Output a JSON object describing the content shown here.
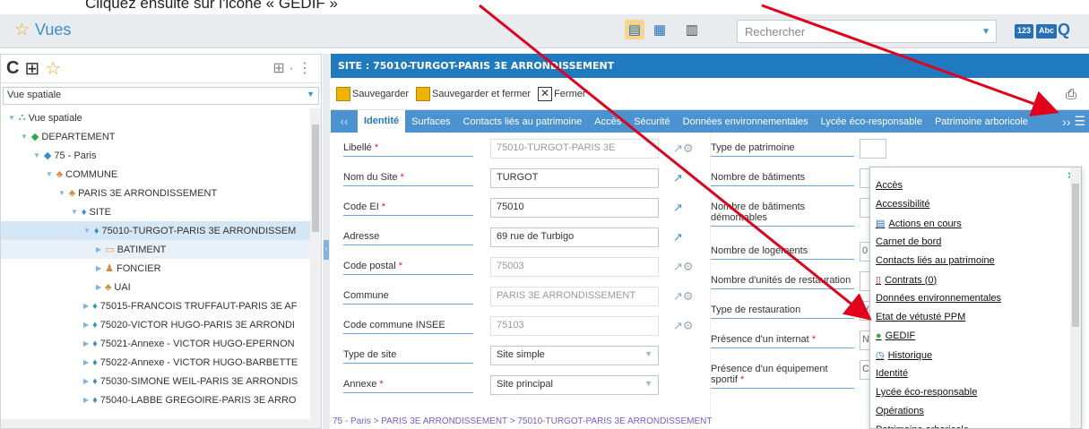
{
  "doc_text": "Cliquez ensuite sur l'icône « GEDIF »",
  "app": {
    "title": "Vues"
  },
  "search": {
    "placeholder": "Rechercher"
  },
  "toolbar_badges": {
    "num": "123",
    "abc": "Abc"
  },
  "left": {
    "view_select": "Vue spatiale",
    "tree": [
      {
        "label": "Vue spatiale",
        "indent": 8,
        "icon": "tree-icon",
        "state": "open"
      },
      {
        "label": "DEPARTEMENT",
        "indent": 22,
        "icon": "folder-green-icon",
        "state": "open"
      },
      {
        "label": "75 - Paris",
        "indent": 36,
        "icon": "globe-icon",
        "state": "open"
      },
      {
        "label": "COMMUNE",
        "indent": 50,
        "icon": "commune-icon",
        "state": "open"
      },
      {
        "label": "PARIS 3E ARRONDISSEMENT",
        "indent": 64,
        "icon": "commune-icon",
        "state": "open"
      },
      {
        "label": "SITE",
        "indent": 78,
        "icon": "site-icon",
        "state": "open"
      },
      {
        "label": "75010-TURGOT-PARIS 3E ARRONDISSEM",
        "indent": 92,
        "icon": "site-icon",
        "state": "open",
        "selected": true
      },
      {
        "label": "BATIMENT",
        "indent": 106,
        "icon": "building-icon",
        "state": "closed",
        "highlight": true
      },
      {
        "label": "FONCIER",
        "indent": 106,
        "icon": "foncier-icon",
        "state": "closed"
      },
      {
        "label": "UAI",
        "indent": 106,
        "icon": "commune-icon",
        "state": "closed"
      },
      {
        "label": "75015-FRANCOIS TRUFFAUT-PARIS 3E AF",
        "indent": 92,
        "icon": "site-icon",
        "state": "closed"
      },
      {
        "label": "75020-VICTOR HUGO-PARIS 3E ARRONDI",
        "indent": 92,
        "icon": "site-icon",
        "state": "closed"
      },
      {
        "label": "75021-Annexe - VICTOR HUGO-EPERNON",
        "indent": 92,
        "icon": "site-icon",
        "state": "closed"
      },
      {
        "label": "75022-Annexe - VICTOR HUGO-BARBETTE",
        "indent": 92,
        "icon": "site-icon",
        "state": "closed"
      },
      {
        "label": "75030-SIMONE WEIL-PARIS 3E ARRONDIS",
        "indent": 92,
        "icon": "site-icon",
        "state": "closed"
      },
      {
        "label": "75040-LABBE GREGOIRE-PARIS 3E ARRO",
        "indent": 92,
        "icon": "site-icon",
        "state": "closed"
      }
    ]
  },
  "main": {
    "header": "SITE : 75010-TURGOT-PARIS 3E ARRONDISSEMENT",
    "actions": {
      "save": "Sauvegarder",
      "save_close": "Sauvegarder et fermer",
      "close": "Fermer"
    },
    "tabs": [
      "Identité",
      "Surfaces",
      "Contacts liés au patrimoine",
      "Accès",
      "Sécurité",
      "Données environnementales",
      "Lycée éco-responsable",
      "Patrimoine arboricole"
    ],
    "fields": [
      {
        "label": "Libellé",
        "required": true,
        "value": "75010-TURGOT-PARIS 3E",
        "readonly": true
      },
      {
        "label": "Nom du Site",
        "required": true,
        "value": "TURGOT"
      },
      {
        "label": "Code EI",
        "required": true,
        "value": "75010"
      },
      {
        "label": "Adresse",
        "required": false,
        "value": "69 rue de Turbigo"
      },
      {
        "label": "Code postal",
        "required": true,
        "value": "75003",
        "readonly": true
      },
      {
        "label": "Commune",
        "required": false,
        "value": "PARIS 3E ARRONDISSEMENT",
        "readonly": true
      },
      {
        "label": "Code commune INSEE",
        "required": false,
        "value": "75103",
        "readonly": true
      },
      {
        "label": "Type de site",
        "required": false,
        "value": "Site simple",
        "select": true
      },
      {
        "label": "Annexe",
        "required": true,
        "value": "Site principal",
        "select": true
      }
    ],
    "right_fields": [
      {
        "label": "Type de patrimoine",
        "value": ""
      },
      {
        "label": "Nombre de bâtiments",
        "value": ""
      },
      {
        "label": "Nombre de bâtiments démontables",
        "value": ""
      },
      {
        "label": "Nombre de logements",
        "value": "0"
      },
      {
        "label": "Nombre d'unités de restauration",
        "value": ""
      },
      {
        "label": "Type de restauration",
        "value": "V"
      },
      {
        "label": "Présence d'un internat",
        "value": "N",
        "required": true
      },
      {
        "label": "Présence d'un équipement sportif",
        "value": "C",
        "required": true
      }
    ],
    "breadcrumb": "75 - Paris > PARIS 3E ARRONDISSEMENT > 75010-TURGOT-PARIS 3E ARRONDISSEMENT"
  },
  "dropdown": {
    "items": [
      {
        "label": "Accès",
        "icon": ""
      },
      {
        "label": "Accessibilité",
        "icon": ""
      },
      {
        "label": "Actions en cours",
        "icon": "clipboard-icon"
      },
      {
        "label": "Carnet de bord",
        "icon": ""
      },
      {
        "label": "Contacts liés au patrimoine",
        "icon": ""
      },
      {
        "label": "Contrats (0)",
        "icon": "contract-icon"
      },
      {
        "label": "Données environnementales",
        "icon": ""
      },
      {
        "label": "Etat de vétusté PPM",
        "icon": ""
      },
      {
        "label": "GEDIF",
        "icon": "gedif-icon"
      },
      {
        "label": "Historique",
        "icon": "history-icon"
      },
      {
        "label": "Identité",
        "icon": ""
      },
      {
        "label": "Lycée éco-responsable",
        "icon": ""
      },
      {
        "label": "Opérations",
        "icon": ""
      },
      {
        "label": "Patrimoine arboricole",
        "icon": ""
      }
    ]
  },
  "colors": {
    "header_blue": "#1f7ac0",
    "tab_blue": "#4a93d0",
    "arrow_red": "#e3001b",
    "star": "#f2a81d"
  }
}
